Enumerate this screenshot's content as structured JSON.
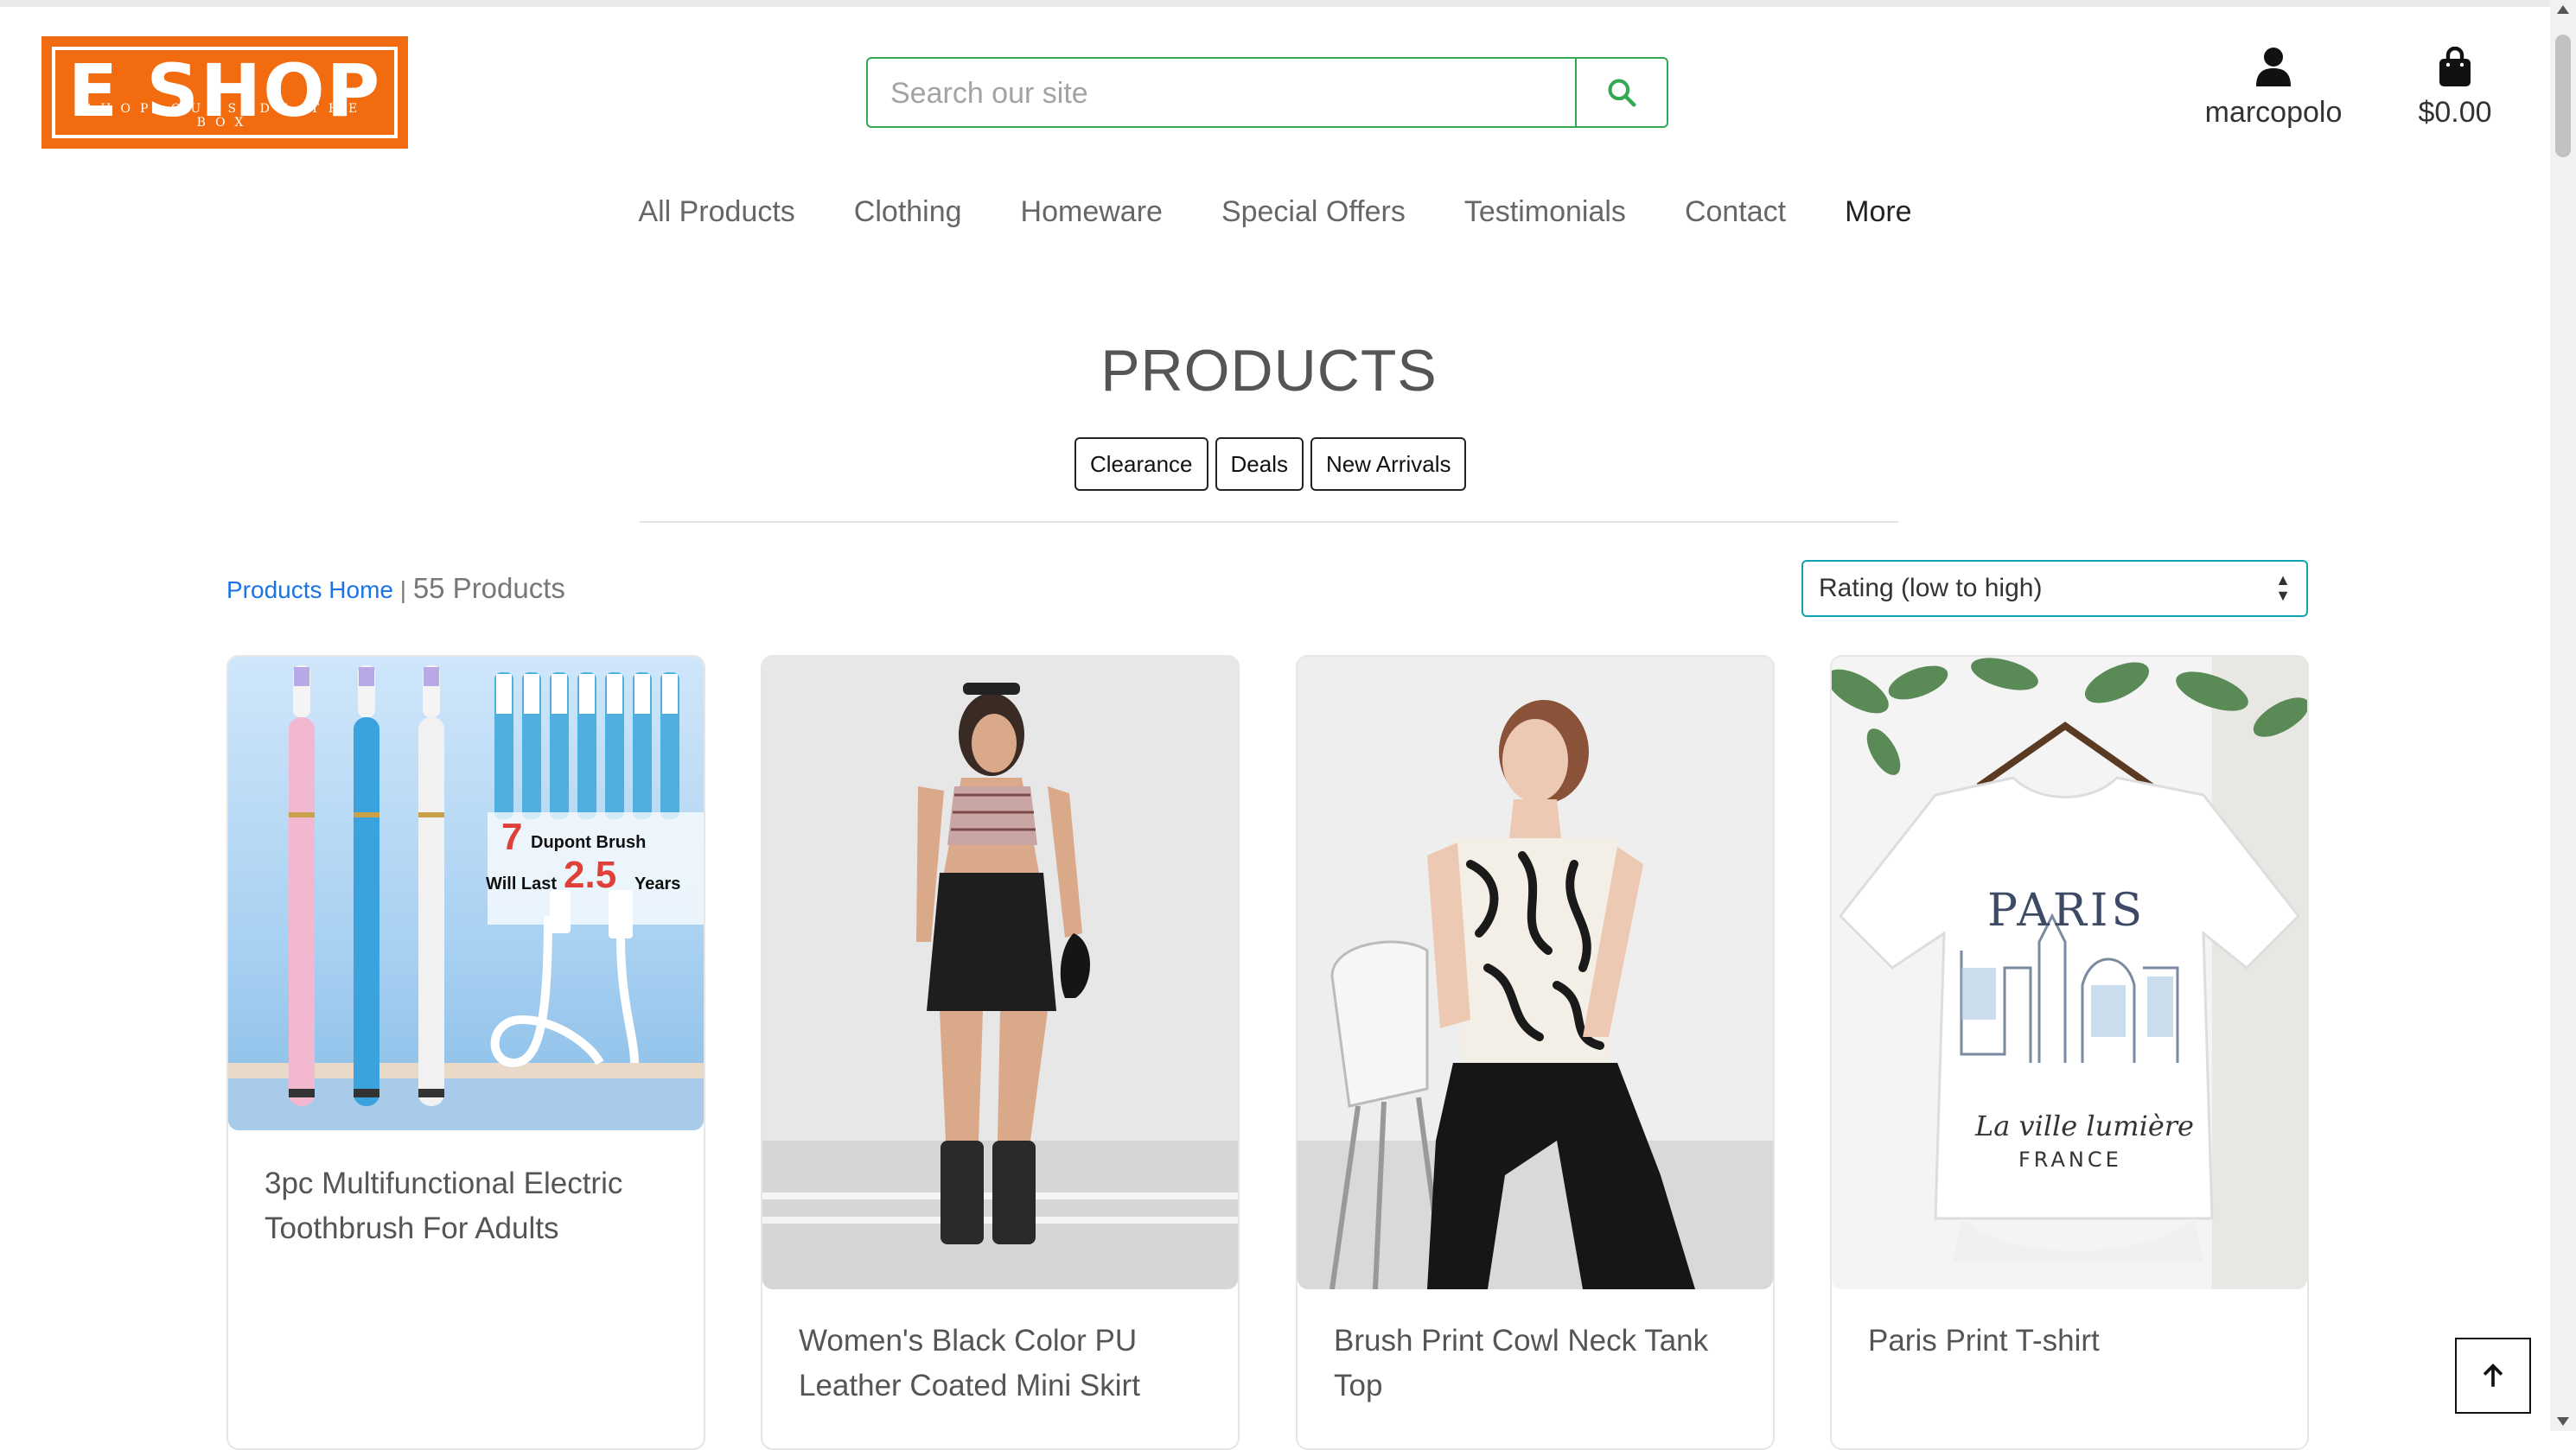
{
  "header": {
    "logo_text": "E SHOP",
    "logo_tagline": "SHOP OUTSIDE THE BOX",
    "search_placeholder": "Search our site",
    "account_label": "marcopolo",
    "cart_total": "$0.00"
  },
  "nav": {
    "items": [
      "All Products",
      "Clothing",
      "Homeware",
      "Special Offers",
      "Testimonials",
      "Contact",
      "More"
    ]
  },
  "products_page": {
    "title": "PRODUCTS",
    "filters": [
      "Clearance",
      "Deals",
      "New Arrivals"
    ],
    "breadcrumb_home": "Products Home",
    "breadcrumb_sep": "|",
    "product_count": "55 Products",
    "sort_selected": "Rating (low to high)"
  },
  "products": [
    {
      "name": "3pc Multifunctional Electric Toothbrush For Adults",
      "image_text": {
        "count": "7",
        "brush": "Dupont Brush",
        "will_last": "Will Last",
        "years_num": "2.5",
        "years": "Years"
      }
    },
    {
      "name": "Women's Black Color PU Leather Coated Mini Skirt"
    },
    {
      "name": "Brush Print Cowl Neck Tank Top"
    },
    {
      "name": "Paris Print T-shirt",
      "image_text": {
        "paris": "PARIS",
        "script": "La ville lumière",
        "country": "FRANCE"
      }
    }
  ],
  "colors": {
    "brand_orange": "#f26b0f",
    "search_green": "#34a853",
    "link_blue": "#1a73e8",
    "sort_teal": "#0fa3b1"
  },
  "icons": [
    "search-icon",
    "user-icon",
    "shopping-bag-icon",
    "arrow-up-icon"
  ]
}
